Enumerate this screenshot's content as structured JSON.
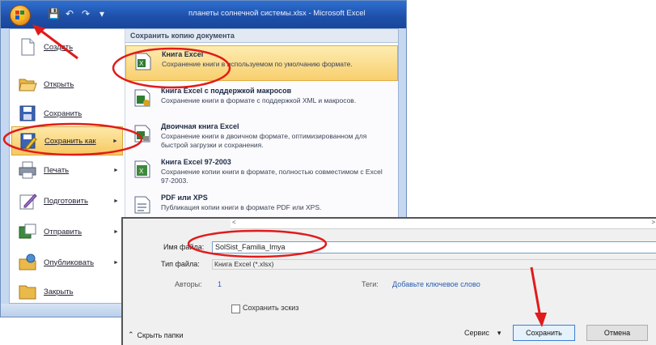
{
  "window": {
    "title": "планеты солнечной системы.xlsx - Microsoft Excel"
  },
  "quick_access": {
    "icons": [
      "save-icon",
      "undo-icon",
      "redo-icon",
      "customize-icon"
    ],
    "glyphs": [
      "💾",
      "↶",
      "↷",
      "▾"
    ]
  },
  "office_menu": {
    "commands": [
      {
        "label": "Создать",
        "icon": "new-document-icon"
      },
      {
        "label": "Открыть",
        "icon": "open-folder-icon"
      },
      {
        "label": "Сохранить",
        "icon": "save-icon"
      },
      {
        "label": "Сохранить как",
        "icon": "save-as-icon"
      },
      {
        "label": "Печать",
        "icon": "print-icon"
      },
      {
        "label": "Подготовить",
        "icon": "prepare-icon"
      },
      {
        "label": "Отправить",
        "icon": "send-icon"
      },
      {
        "label": "Опубликовать",
        "icon": "publish-icon"
      },
      {
        "label": "Закрыть",
        "icon": "close-folder-icon"
      }
    ],
    "submenu_arrow": "►",
    "right_header": "Сохранить копию документа",
    "save_options": [
      {
        "title": "Книга Excel",
        "desc": "Сохранение книги в используемом по умолчанию формате."
      },
      {
        "title": "Книга Excel с поддержкой макросов",
        "desc": "Сохранение книги в формате с поддержкой XML и макросов."
      },
      {
        "title": "Двоичная книга Excel",
        "desc": "Сохранение книги в двоичном формате, оптимизированном для быстрой загрузки и сохранения."
      },
      {
        "title": "Книга Excel 97-2003",
        "desc": "Сохранение копии книги в формате, полностью совместимом с Excel 97-2003."
      },
      {
        "title": "PDF или XPS",
        "desc": "Публикация копии книги в формате PDF или XPS."
      }
    ]
  },
  "save_dialog": {
    "scroll_left": "<",
    "scroll_right": ">",
    "filename_label": "Имя файла:",
    "filename_value": "SolSist_Familia_Imya",
    "filetype_label": "Тип файла:",
    "filetype_value": "Книга Excel (*.xlsx)",
    "authors_label": "Авторы:",
    "authors_value": "1",
    "tags_label": "Теги:",
    "tags_value": "Добавьте ключевое слово",
    "thumbnail_label": "Сохранить эскиз",
    "thumbnail_checked": false,
    "hide_folders_label": "Скрыть папки",
    "service_label": "Сервис",
    "save_label": "Сохранить",
    "cancel_label": "Отмена"
  },
  "colors": {
    "annotation_red": "#e11b1b",
    "titlebar_blue": "#1d4fa8",
    "highlight_amber": "#f7c861"
  }
}
